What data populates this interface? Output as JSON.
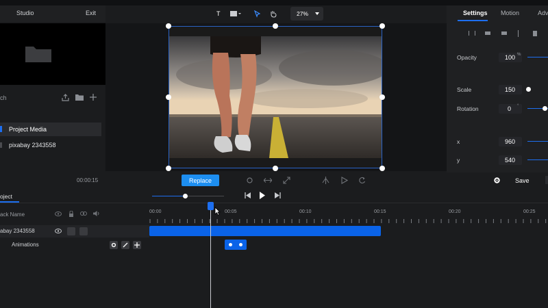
{
  "left_header": {
    "studio": "Studio",
    "exit": "Exit"
  },
  "search": {
    "partial_label": "ch"
  },
  "media_list": [
    {
      "label": "Project Media",
      "selected": true
    },
    {
      "label": "pixabay 2343558",
      "selected": false
    }
  ],
  "toolbar": {
    "zoom": "27%"
  },
  "right_tabs": {
    "settings": "Settings",
    "motion": "Motion",
    "adv": "Adv"
  },
  "properties": {
    "opacity_label": "Opacity",
    "opacity_value": "100",
    "scale_label": "Scale",
    "scale_value": "150",
    "rotation_label": "Rotation",
    "rotation_value": "0",
    "x_label": "x",
    "x_value": "960",
    "y_label": "y",
    "y_value": "540"
  },
  "canvas_footer": {
    "time": "00:00:15",
    "replace": "Replace",
    "save": "Save"
  },
  "timeline": {
    "tab": "oject",
    "track_name_header": "ack Name",
    "track_label": "abay 2343558",
    "animations_label": "Animations",
    "ticks": [
      "00:00",
      "00:05",
      "00:10",
      "00:15",
      "00:20",
      "00:25"
    ]
  },
  "colors": {
    "accent": "#1d8ef0",
    "track": "#0a63e8"
  }
}
